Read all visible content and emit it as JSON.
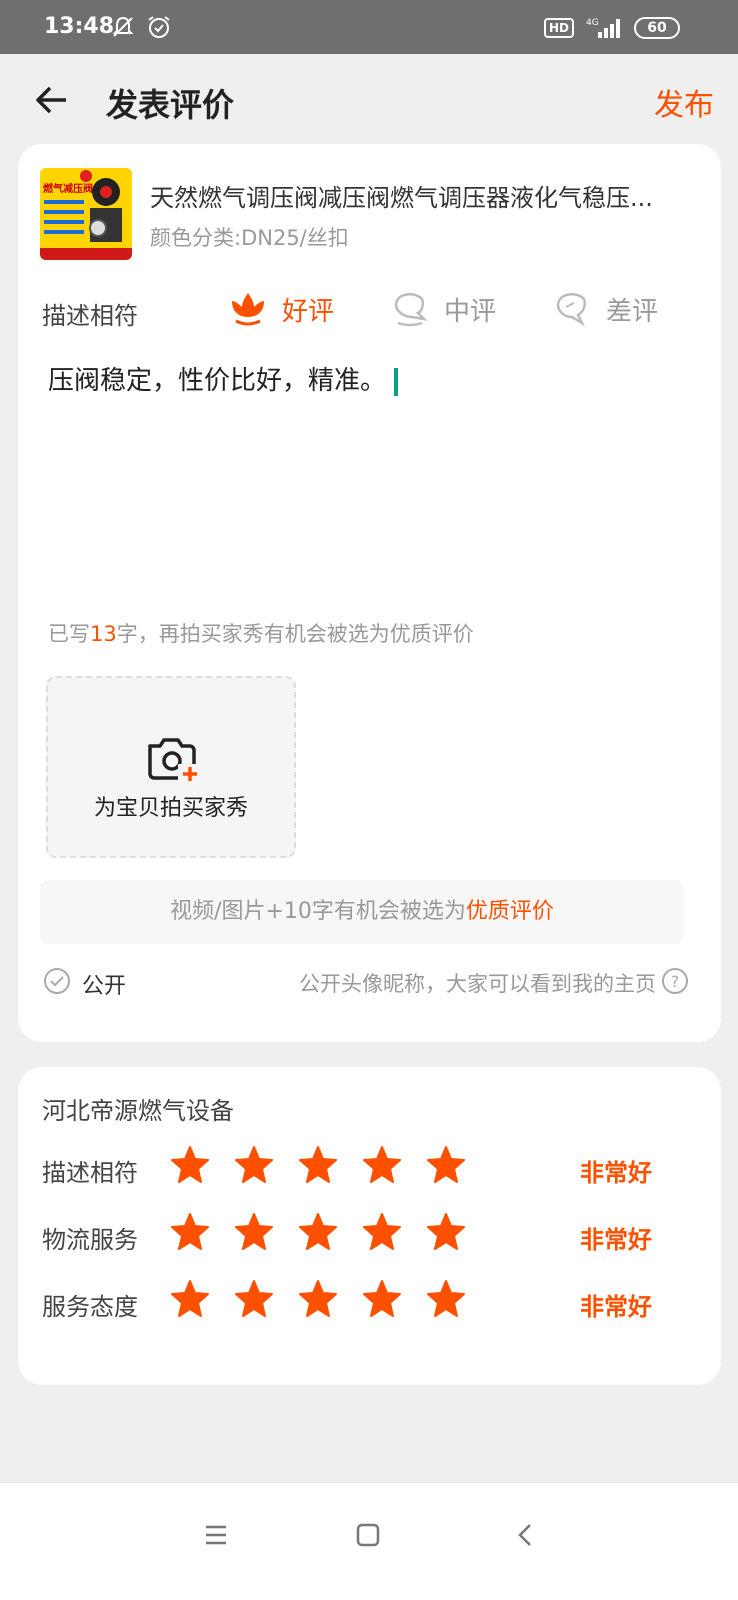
{
  "status_bar": {
    "time": "13:48",
    "icons_left": [
      "mute-icon",
      "alarm-icon"
    ],
    "hd": "HD",
    "network": "4G",
    "battery": "60"
  },
  "header": {
    "title": "发表评价",
    "publish_label": "发布",
    "back_icon": "arrow-left-icon"
  },
  "product": {
    "title": "天然燃气调压阀减压阀燃气调压器液化气稳压...",
    "sku": "颜色分类:DN25/丝扣",
    "thumb_text": "燃气减压阀"
  },
  "rating": {
    "label": "描述相符",
    "options": [
      {
        "label": "好评",
        "selected": true,
        "icon": "flower-good-icon"
      },
      {
        "label": "中评",
        "selected": false,
        "icon": "flower-mid-icon"
      },
      {
        "label": "差评",
        "selected": false,
        "icon": "flower-bad-icon"
      }
    ]
  },
  "review": {
    "text": "压阀稳定，性价比好，精准。"
  },
  "char_hint": {
    "prefix": "已写",
    "count": "13",
    "suffix": "字，再拍买家秀有机会被选为优质评价"
  },
  "photo": {
    "label": "为宝贝拍买家秀"
  },
  "tip": {
    "text": "视频/图片+10字有机会被选为",
    "highlight": "优质评价"
  },
  "public": {
    "label": "公开",
    "description": "公开头像昵称，大家可以看到我的主页",
    "checked": true
  },
  "shop": {
    "name": "河北帝源燃气设备",
    "scores": [
      {
        "label": "描述相符",
        "stars": 5,
        "text": "非常好"
      },
      {
        "label": "物流服务",
        "stars": 5,
        "text": "非常好"
      },
      {
        "label": "服务态度",
        "stars": 5,
        "text": "非常好"
      }
    ]
  },
  "colors": {
    "accent": "#ff5000",
    "cursor": "#0e9e86"
  }
}
